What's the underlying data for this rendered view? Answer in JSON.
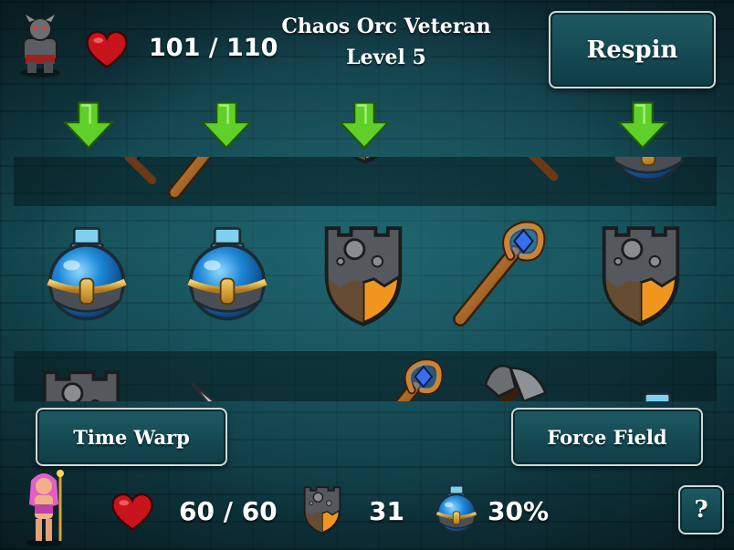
{
  "enemy": {
    "name": "Chaos Orc Veteran",
    "level": "Level 5",
    "hp": "101 / 110"
  },
  "buttons": {
    "respin": "Respin",
    "time_warp": "Time Warp",
    "force_field": "Force Field",
    "help": "?"
  },
  "player": {
    "hp": "60 / 60",
    "shield": "31",
    "potion": "30%"
  },
  "reels": {
    "held_columns": [
      1,
      2,
      3,
      5
    ],
    "top_row": [
      "swords",
      "staff",
      "shield",
      "sword",
      "potion"
    ],
    "middle_row": [
      "potion",
      "potion",
      "shield",
      "staff",
      "shield"
    ],
    "bottom_row": [
      "shield",
      "sword",
      "staff",
      "axe",
      "potion"
    ]
  },
  "colors": {
    "arrow": "#5fd02a",
    "heart": "#c8141c",
    "button_border": "#cfd8d8",
    "potion_blue": "#1e88d8",
    "gold": "#d8a23a",
    "shield_grey": "#55585c",
    "shield_orange": "#f0961e"
  },
  "icons": [
    "orc-portrait-icon",
    "heart-icon",
    "down-arrow-icon",
    "potion-icon",
    "shield-icon",
    "staff-icon",
    "sword-icon",
    "axe-icon",
    "swords-icon",
    "hero-portrait-icon"
  ]
}
